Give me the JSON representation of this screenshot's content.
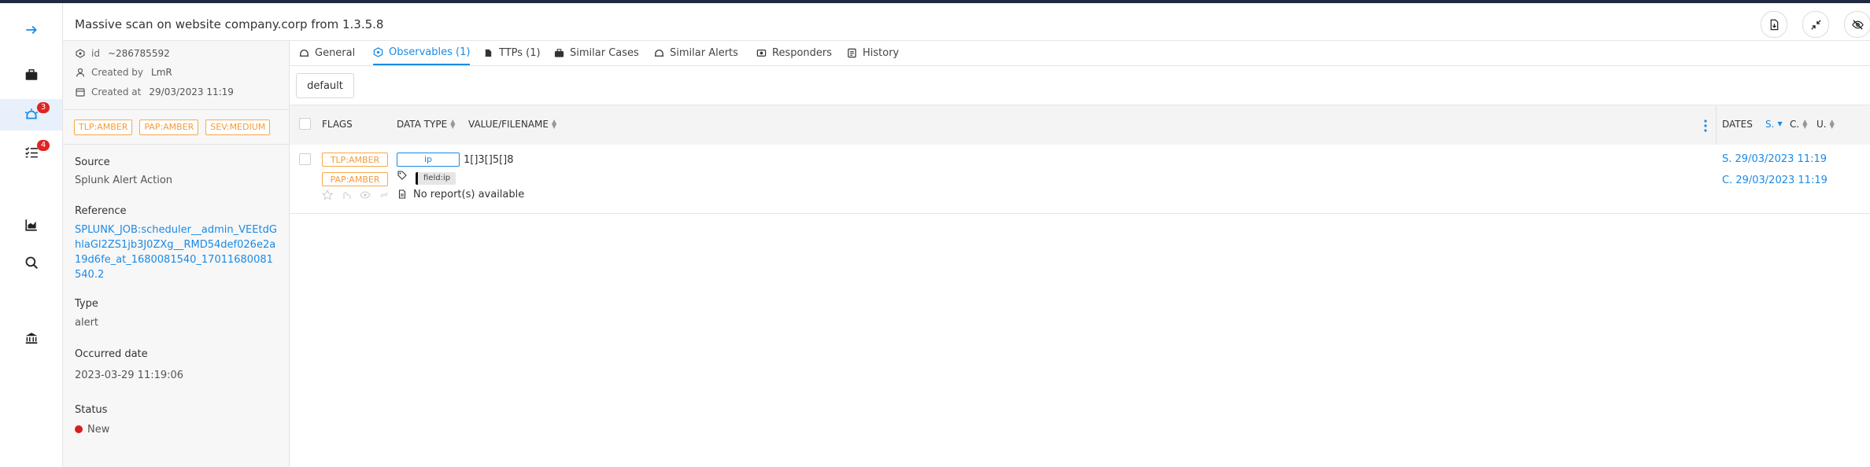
{
  "header": {
    "title": "Massive scan on website company.corp from 1.3.5.8"
  },
  "nav": {
    "alerts_badge": "3",
    "tasks_badge": "4"
  },
  "details": {
    "id_label": "id",
    "id_value": "~286785592",
    "created_by_label": "Created by",
    "created_by_value": "LmR",
    "created_at_label": "Created at",
    "created_at_value": "29/03/2023 11:19",
    "tags": [
      "TLP:AMBER",
      "PAP:AMBER",
      "SEV:MEDIUM"
    ],
    "source_title": "Source",
    "source_value": "Splunk Alert Action",
    "reference_title": "Reference",
    "reference_value": "SPLUNK_JOB:scheduler__admin_VEEtdGhlaGl2ZS1jb3J0ZXg__RMD54def026e2a19d6fe_at_1680081540_17011680081540.2",
    "type_title": "Type",
    "type_value": "alert",
    "occurred_title": "Occurred date",
    "occurred_value": "2023-03-29 11:19:06",
    "status_title": "Status",
    "status_value": "New"
  },
  "tabs": [
    {
      "label": "General"
    },
    {
      "label": "Observables (1)"
    },
    {
      "label": "TTPs (1)"
    },
    {
      "label": "Similar Cases"
    },
    {
      "label": "Similar Alerts"
    },
    {
      "label": "Responders"
    },
    {
      "label": "History"
    }
  ],
  "toolbar": {
    "default_label": "default"
  },
  "table": {
    "columns": {
      "flags": "FLAGS",
      "data_type": "DATA TYPE",
      "value": "VALUE/FILENAME",
      "dates": "DATES",
      "s": "S.",
      "c": "C.",
      "u": "U."
    },
    "rows": [
      {
        "flag_tlp": "TLP:AMBER",
        "flag_pap": "PAP:AMBER",
        "data_type": "ip",
        "value": "1[]3[]5[]8",
        "tag": "field:ip",
        "report": "No report(s) available",
        "date_s": "S. 29/03/2023 11:19",
        "date_c": "C. 29/03/2023 11:19"
      }
    ]
  },
  "colors": {
    "accent": "#1a8ae6",
    "amber": "#f39c3c",
    "badge": "#e02424",
    "status_new": "#d61e1e"
  }
}
